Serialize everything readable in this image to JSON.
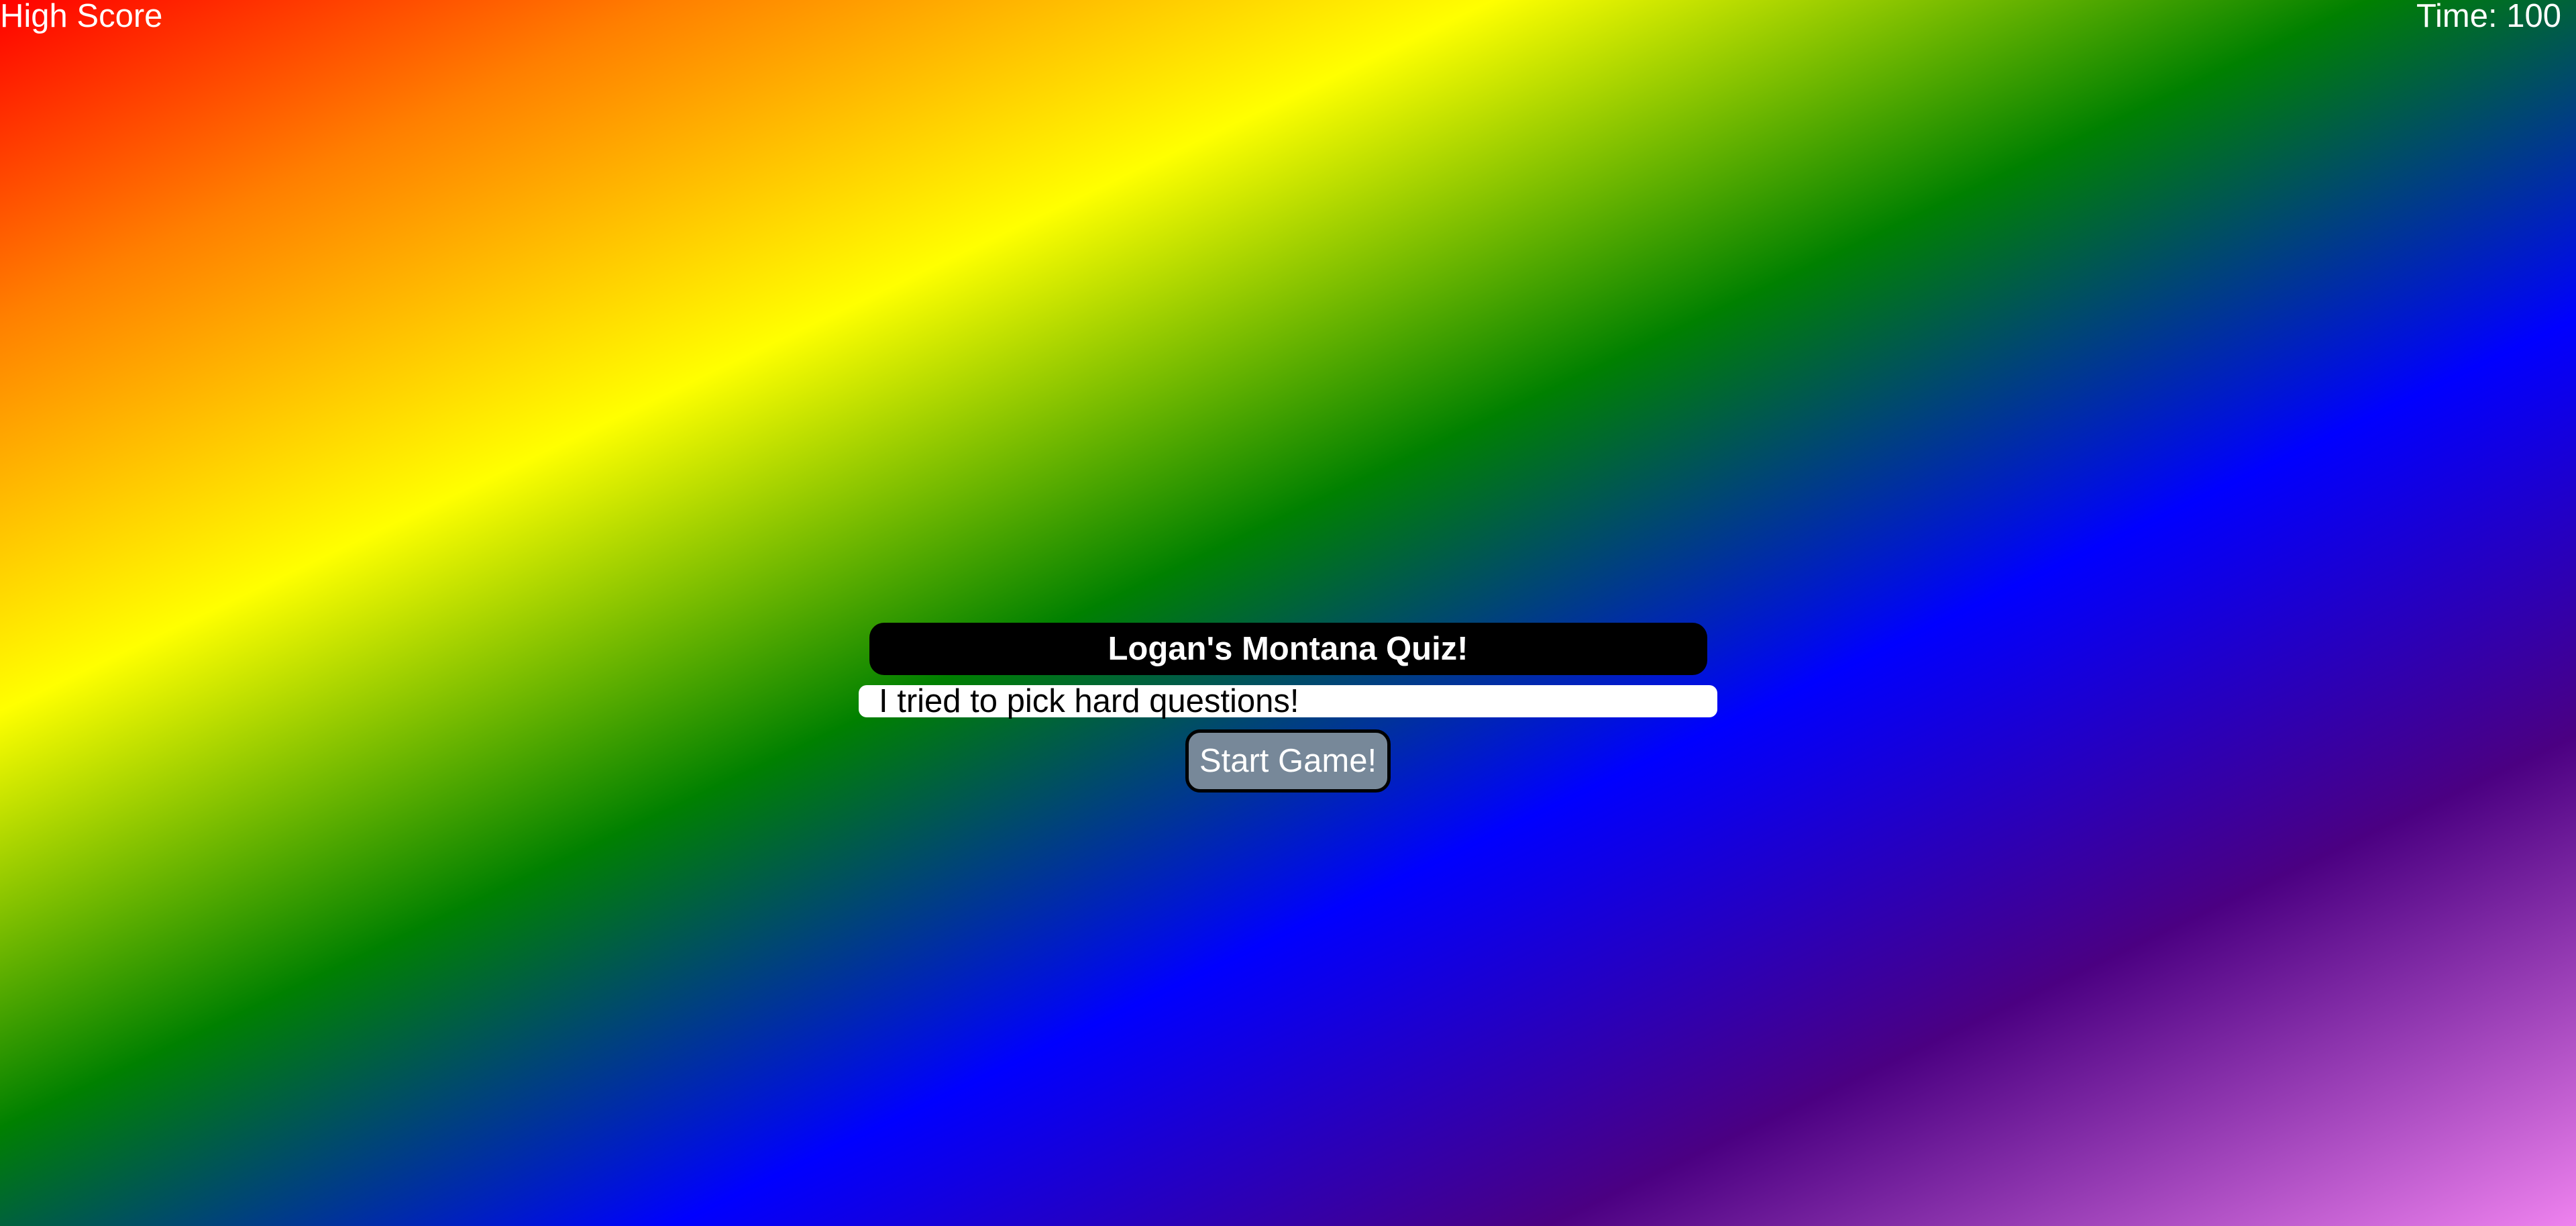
{
  "header": {
    "high_score_label": "High Score",
    "timer_text": "Time: 100"
  },
  "quiz": {
    "title": "Logan's Montana Quiz!",
    "subtitle": "I tried to pick hard questions!",
    "start_label": "Start Game!"
  },
  "colors": {
    "background_gradient": [
      "#ff0000",
      "#ff7f00",
      "#ffff00",
      "#008000",
      "#0000ff",
      "#4b0082",
      "#ee82ee"
    ],
    "title_bg": "#000000",
    "subtitle_bg": "#ffffff",
    "button_bg": "#778899"
  }
}
